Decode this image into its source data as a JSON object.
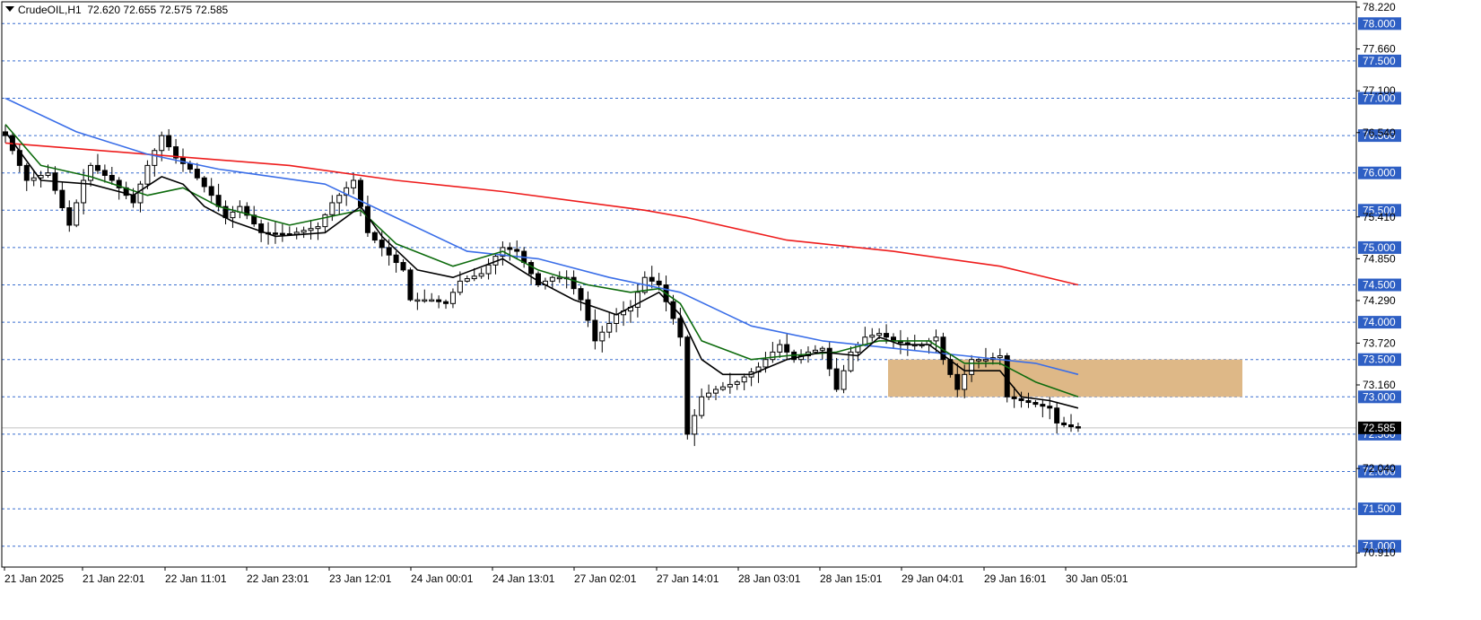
{
  "header": {
    "symbol": "CrudeOIL,H1",
    "ohlc": "72.620 72.655 72.575 72.585"
  },
  "colors": {
    "background": "#ffffff",
    "grid": "#3a6fd0",
    "level_label_bg": "#2e5fc4",
    "ma_red": "#ee1c1c",
    "ma_blue": "#3a6ee8",
    "ma_green": "#0d6b0d",
    "ma_black": "#000000",
    "zone": "#deb887",
    "candle_up": "#ffffff",
    "candle_down": "#000000"
  },
  "chart_data": {
    "type": "candlestick",
    "symbol": "CrudeOIL",
    "timeframe": "H1",
    "ylim": [
      70.8,
      78.3
    ],
    "grid": "horizontal dashed at each 0.5 level",
    "y_tick_labels": [
      "78.220",
      "77.660",
      "77.100",
      "76.540",
      "75.410",
      "74.850",
      "74.290",
      "73.720",
      "73.160",
      "72.040",
      "70.910"
    ],
    "level_labels": [
      "78.000",
      "77.500",
      "77.000",
      "76.500",
      "76.000",
      "75.500",
      "75.000",
      "74.500",
      "74.000",
      "73.500",
      "73.000",
      "72.500",
      "72.000",
      "71.500",
      "71.000"
    ],
    "current_price": "72.585",
    "x_tick_labels": [
      "21 Jan 2025",
      "21 Jan 22:01",
      "22 Jan 11:01",
      "22 Jan 23:01",
      "23 Jan 12:01",
      "24 Jan 00:01",
      "24 Jan 13:01",
      "27 Jan 02:01",
      "27 Jan 14:01",
      "28 Jan 03:01",
      "28 Jan 15:01",
      "29 Jan 04:01",
      "29 Jan 16:01",
      "30 Jan 05:01"
    ],
    "supply_zone": {
      "from": 73.0,
      "to": 73.5
    },
    "price_path": [
      [
        0,
        76.5
      ],
      [
        3,
        75.9
      ],
      [
        6,
        76.0
      ],
      [
        9,
        75.3
      ],
      [
        11,
        75.9
      ],
      [
        12,
        76.1
      ],
      [
        15,
        75.9
      ],
      [
        18,
        75.6
      ],
      [
        20,
        76.1
      ],
      [
        22,
        76.5
      ],
      [
        24,
        76.2
      ],
      [
        26,
        76.05
      ],
      [
        29,
        75.7
      ],
      [
        31,
        75.4
      ],
      [
        33,
        75.55
      ],
      [
        36,
        75.2
      ],
      [
        40,
        75.18
      ],
      [
        44,
        75.28
      ],
      [
        46,
        75.6
      ],
      [
        49,
        75.9
      ],
      [
        51,
        75.2
      ],
      [
        53,
        75.0
      ],
      [
        56,
        74.7
      ],
      [
        57,
        74.3
      ],
      [
        60,
        74.3
      ],
      [
        62,
        74.25
      ],
      [
        64,
        74.55
      ],
      [
        67,
        74.65
      ],
      [
        70,
        75.0
      ],
      [
        72,
        74.95
      ],
      [
        75,
        74.5
      ],
      [
        77,
        74.6
      ],
      [
        79,
        74.6
      ],
      [
        81,
        74.3
      ],
      [
        83,
        73.75
      ],
      [
        86,
        74.1
      ],
      [
        88,
        74.2
      ],
      [
        90,
        74.6
      ],
      [
        92,
        74.5
      ],
      [
        94,
        74.05
      ],
      [
        95,
        73.8
      ],
      [
        96,
        72.5
      ],
      [
        98,
        73.0
      ],
      [
        100,
        73.1
      ],
      [
        103,
        73.2
      ],
      [
        106,
        73.4
      ],
      [
        109,
        73.7
      ],
      [
        111,
        73.5
      ],
      [
        113,
        73.6
      ],
      [
        115,
        73.65
      ],
      [
        117,
        73.1
      ],
      [
        119,
        73.6
      ],
      [
        121,
        73.8
      ],
      [
        123,
        73.85
      ],
      [
        125,
        73.75
      ],
      [
        127,
        73.7
      ],
      [
        129,
        73.7
      ],
      [
        131,
        73.8
      ],
      [
        132,
        73.5
      ],
      [
        134,
        73.1
      ],
      [
        136,
        73.5
      ],
      [
        138,
        73.5
      ],
      [
        140,
        73.55
      ],
      [
        141,
        73.0
      ],
      [
        143,
        72.95
      ],
      [
        145,
        72.9
      ],
      [
        147,
        72.85
      ],
      [
        148,
        72.65
      ],
      [
        150,
        72.6
      ],
      [
        151,
        72.585
      ]
    ],
    "series": [
      {
        "color": "red",
        "values": [
          [
            0,
            76.4
          ],
          [
            20,
            76.25
          ],
          [
            40,
            76.1
          ],
          [
            55,
            75.9
          ],
          [
            70,
            75.75
          ],
          [
            90,
            75.5
          ],
          [
            96,
            75.4
          ],
          [
            110,
            75.1
          ],
          [
            125,
            74.95
          ],
          [
            140,
            74.75
          ],
          [
            151,
            74.5
          ]
        ]
      },
      {
        "color": "blue",
        "values": [
          [
            0,
            77.0
          ],
          [
            10,
            76.55
          ],
          [
            20,
            76.25
          ],
          [
            30,
            76.05
          ],
          [
            45,
            75.85
          ],
          [
            55,
            75.4
          ],
          [
            65,
            74.95
          ],
          [
            75,
            74.85
          ],
          [
            85,
            74.6
          ],
          [
            95,
            74.4
          ],
          [
            105,
            73.95
          ],
          [
            115,
            73.75
          ],
          [
            125,
            73.65
          ],
          [
            135,
            73.55
          ],
          [
            145,
            73.45
          ],
          [
            151,
            73.3
          ]
        ]
      },
      {
        "color": "green",
        "values": [
          [
            0,
            76.65
          ],
          [
            5,
            76.1
          ],
          [
            12,
            75.95
          ],
          [
            20,
            75.7
          ],
          [
            25,
            75.8
          ],
          [
            30,
            75.55
          ],
          [
            40,
            75.3
          ],
          [
            45,
            75.4
          ],
          [
            50,
            75.5
          ],
          [
            55,
            75.05
          ],
          [
            63,
            74.75
          ],
          [
            70,
            74.95
          ],
          [
            75,
            74.7
          ],
          [
            82,
            74.5
          ],
          [
            88,
            74.4
          ],
          [
            92,
            74.45
          ],
          [
            95,
            74.25
          ],
          [
            98,
            73.75
          ],
          [
            105,
            73.5
          ],
          [
            110,
            73.55
          ],
          [
            117,
            73.6
          ],
          [
            123,
            73.75
          ],
          [
            130,
            73.75
          ],
          [
            135,
            73.45
          ],
          [
            140,
            73.45
          ],
          [
            145,
            73.2
          ],
          [
            151,
            73.0
          ]
        ]
      },
      {
        "color": "black",
        "values": [
          [
            0,
            76.55
          ],
          [
            5,
            75.9
          ],
          [
            12,
            75.85
          ],
          [
            18,
            75.7
          ],
          [
            22,
            75.95
          ],
          [
            25,
            75.85
          ],
          [
            28,
            75.55
          ],
          [
            32,
            75.35
          ],
          [
            38,
            75.15
          ],
          [
            45,
            75.2
          ],
          [
            50,
            75.55
          ],
          [
            53,
            75.15
          ],
          [
            58,
            74.7
          ],
          [
            63,
            74.6
          ],
          [
            70,
            74.85
          ],
          [
            75,
            74.55
          ],
          [
            80,
            74.3
          ],
          [
            86,
            74.1
          ],
          [
            92,
            74.4
          ],
          [
            95,
            74.1
          ],
          [
            98,
            73.5
          ],
          [
            101,
            73.3
          ],
          [
            105,
            73.3
          ],
          [
            110,
            73.5
          ],
          [
            115,
            73.6
          ],
          [
            120,
            73.55
          ],
          [
            123,
            73.8
          ],
          [
            126,
            73.7
          ],
          [
            130,
            73.7
          ],
          [
            135,
            73.35
          ],
          [
            140,
            73.35
          ],
          [
            143,
            73.0
          ],
          [
            147,
            72.95
          ],
          [
            151,
            72.85
          ]
        ]
      }
    ]
  }
}
